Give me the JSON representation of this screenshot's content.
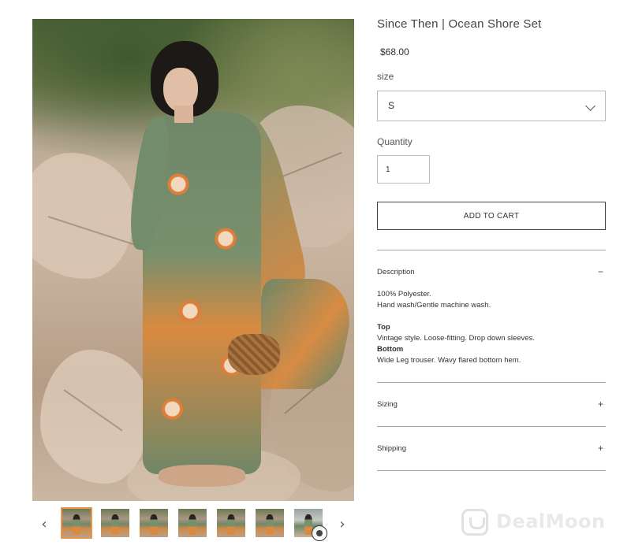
{
  "product": {
    "title": "Since Then | Ocean Shore Set",
    "price": "$68.00"
  },
  "size": {
    "label": "size",
    "selected": "S"
  },
  "quantity": {
    "label": "Quantity",
    "value": "1"
  },
  "cart": {
    "button_label": "ADD TO CART"
  },
  "accordion": {
    "description": {
      "title": "Description",
      "toggle": "−",
      "line1": "100% Polyester.",
      "line2": "Hand wash/Gentle machine wash.",
      "top_heading": "Top",
      "top_text": "Vintage style. Loose-fitting. Drop down sleeves.",
      "bottom_heading": "Bottom",
      "bottom_text": "Wide Leg trouser. Wavy flared bottom hem."
    },
    "sizing": {
      "title": "Sizing",
      "toggle": "+"
    },
    "shipping": {
      "title": "Shipping",
      "toggle": "+"
    }
  },
  "gallery": {
    "prev_arrow": "‹",
    "next_arrow": "›",
    "thumbnail_count": 7,
    "active_index": 0
  },
  "watermark": {
    "text": "DealMoon"
  },
  "colors": {
    "active_thumb_border": "#e8954a",
    "divider": "#a8a8a8",
    "button_border": "#444444"
  }
}
